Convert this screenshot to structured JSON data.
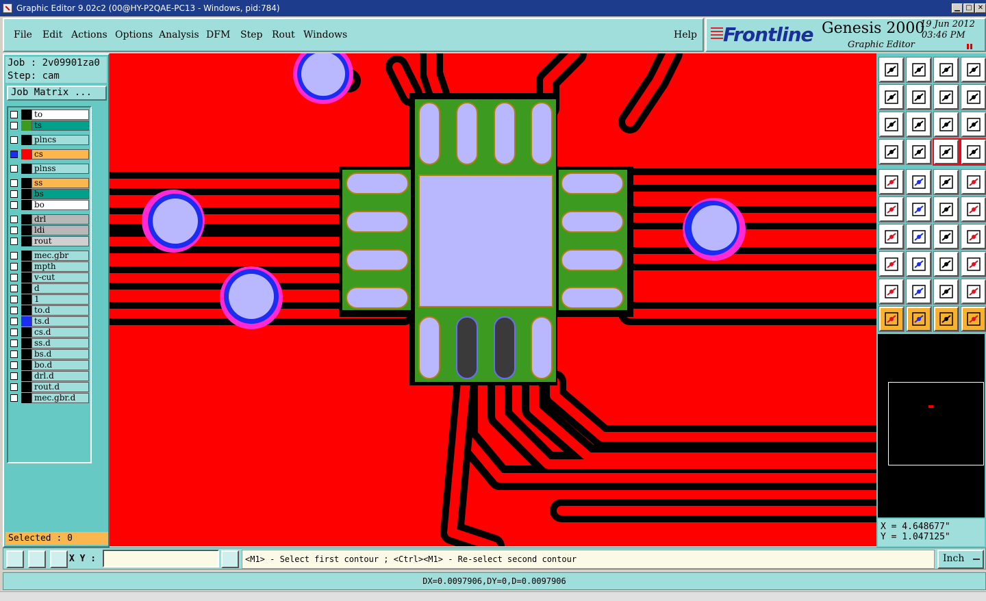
{
  "window": {
    "title": "Graphic Editor 9.02c2 (00@HY-P2QAE-PC13 - Windows, pid:784)",
    "controls": [
      "▁",
      "□",
      "✕"
    ]
  },
  "menu": {
    "items": [
      "File",
      "Edit",
      "Actions",
      "Options",
      "Analysis",
      "DFM",
      "Step",
      "Rout",
      "Windows"
    ],
    "help": "Help"
  },
  "brand": {
    "logo": "Frontline",
    "product": "Genesis 2000",
    "subtitle": "Graphic Editor",
    "date": "19 Jun 2012",
    "time": "03:46 PM"
  },
  "job": {
    "job_line": "Job : 2v09901za0",
    "step_line": "Step: cam",
    "matrix_button": "Job Matrix ..."
  },
  "layers": [
    {
      "name": "to",
      "color": "#000000",
      "bg": "#ffffff",
      "group": 0
    },
    {
      "name": "ts",
      "color": "#3c9a20",
      "bg": "#00a08a",
      "group": 0
    },
    {
      "name": "plncs",
      "color": "#000000",
      "bg": "#9fdedb",
      "group": 1
    },
    {
      "name": "cs",
      "color": "#ff0000",
      "bg": "#fab74f",
      "group": 2,
      "active": true
    },
    {
      "name": "plnss",
      "color": "#000000",
      "bg": "#9fdedb",
      "group": 3
    },
    {
      "name": "ss",
      "color": "#000000",
      "bg": "#fab74f",
      "group": 4
    },
    {
      "name": "bs",
      "color": "#000000",
      "bg": "#00a08a",
      "group": 4
    },
    {
      "name": "bo",
      "color": "#000000",
      "bg": "#ffffff",
      "group": 4
    },
    {
      "name": "drl",
      "color": "#000000",
      "bg": "#b8b8b8",
      "group": 5
    },
    {
      "name": "ldi",
      "color": "#000000",
      "bg": "#b8b8b8",
      "group": 5
    },
    {
      "name": "rout",
      "color": "#000000",
      "bg": "#d0d0d0",
      "group": 5
    },
    {
      "name": "mec.gbr",
      "color": "#000000",
      "bg": "#9fdedb",
      "group": 6
    },
    {
      "name": "mpth",
      "color": "#000000",
      "bg": "#9fdedb",
      "group": 6
    },
    {
      "name": "v-cut",
      "color": "#000000",
      "bg": "#9fdedb",
      "group": 6
    },
    {
      "name": "d",
      "color": "#000000",
      "bg": "#9fdedb",
      "group": 6
    },
    {
      "name": "1",
      "color": "#000000",
      "bg": "#9fdedb",
      "group": 6
    },
    {
      "name": "to.d",
      "color": "#000000",
      "bg": "#9fdedb",
      "group": 6
    },
    {
      "name": "ts.d",
      "color": "#1c2cf0",
      "bg": "#9fdedb",
      "group": 6
    },
    {
      "name": "cs.d",
      "color": "#000000",
      "bg": "#9fdedb",
      "group": 6
    },
    {
      "name": "ss.d",
      "color": "#000000",
      "bg": "#9fdedb",
      "group": 6
    },
    {
      "name": "bs.d",
      "color": "#000000",
      "bg": "#9fdedb",
      "group": 6
    },
    {
      "name": "bo.d",
      "color": "#000000",
      "bg": "#9fdedb",
      "group": 6
    },
    {
      "name": "drl.d",
      "color": "#000000",
      "bg": "#9fdedb",
      "group": 6
    },
    {
      "name": "rout.d",
      "color": "#000000",
      "bg": "#9fdedb",
      "group": 6
    },
    {
      "name": "mec.gbr.d",
      "color": "#000000",
      "bg": "#9fdedb",
      "group": 6
    }
  ],
  "selected": "Selected : 0",
  "coords": {
    "x": "X = 4.648677\"",
    "y": "Y = 1.047125\""
  },
  "toolbar_icons": [
    "snap-up-icon",
    "snap-down-icon",
    "home-icon",
    "split-window-icon",
    "snap-left-icon",
    "snap-right-icon",
    "undo-zoom-icon",
    "redo-zoom-icon",
    "fit-screen-icon",
    "zoom-center-icon",
    "zoom-1to2-icon",
    "help-query-icon",
    "measure-tools-icon",
    "net-probe-icon",
    "layer-filter-icon",
    "layer-filter-2-icon",
    "add-pad-icon",
    "add-surface-icon",
    "add-text-icon",
    "add-circle-icon",
    "connect-nodes-icon",
    "cross-delete-icon",
    "move-point-icon",
    "move-point-2-icon",
    "draw-line-icon",
    "draw-line-2-icon",
    "rotate-icon",
    "mirror-icon",
    "snap-grid-icon",
    "align-icon",
    "measure-distance-icon",
    "step-repeat-icon",
    "triangle-pad-icon",
    "triangle-outline-icon",
    "triangle-arrow-icon",
    "triangle-edit-icon",
    "select-pointer-icon",
    "select-pointer-2-icon",
    "select-rotate-icon",
    "select-stack-icon"
  ],
  "cmd": {
    "xy_label": "X Y :",
    "xy_value": "",
    "prompt": "<M1> - Select first contour ; <Ctrl><M1> - Re-select second contour",
    "units": "Inch"
  },
  "status": "DX=0.0097906,DY=0,D=0.0097906"
}
